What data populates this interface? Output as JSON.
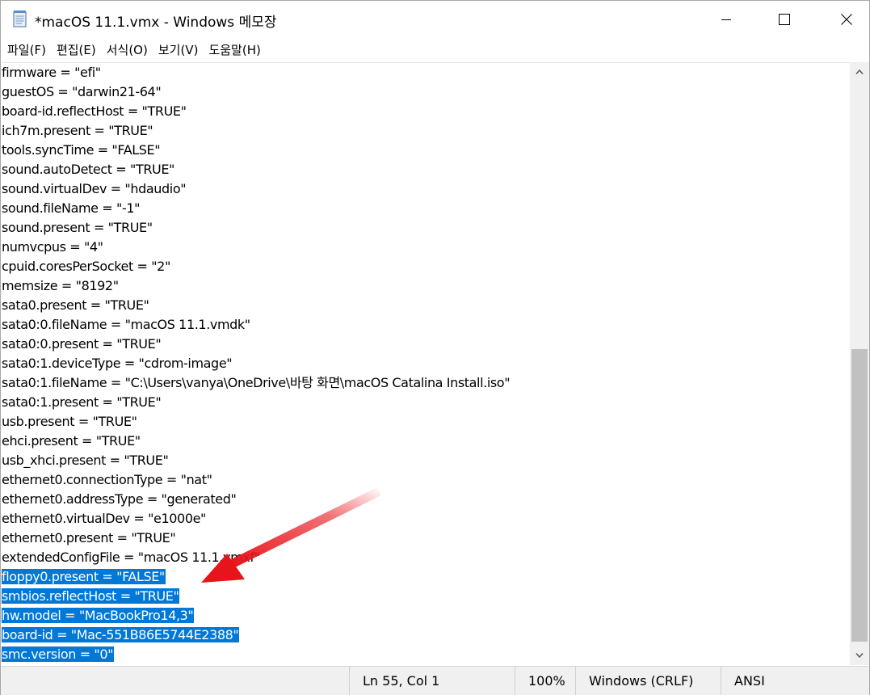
{
  "window": {
    "title": "*macOS 11.1.vmx - Windows 메모장",
    "app_icon": "notepad-icon"
  },
  "menu": {
    "items": [
      "파일(F)",
      "편집(E)",
      "서식(O)",
      "보기(V)",
      "도움말(H)"
    ]
  },
  "editor": {
    "lines": [
      "firmware = \"efi\"",
      "guestOS = \"darwin21-64\"",
      "board-id.reflectHost = \"TRUE\"",
      "ich7m.present = \"TRUE\"",
      "tools.syncTime = \"FALSE\"",
      "sound.autoDetect = \"TRUE\"",
      "sound.virtualDev = \"hdaudio\"",
      "sound.fileName = \"-1\"",
      "sound.present = \"TRUE\"",
      "numvcpus = \"4\"",
      "cpuid.coresPerSocket = \"2\"",
      "memsize = \"8192\"",
      "sata0.present = \"TRUE\"",
      "sata0:0.fileName = \"macOS 11.1.vmdk\"",
      "sata0:0.present = \"TRUE\"",
      "sata0:1.deviceType = \"cdrom-image\"",
      "sata0:1.fileName = \"C:\\Users\\vanya\\OneDrive\\바탕 화면\\macOS Catalina Install.iso\"",
      "sata0:1.present = \"TRUE\"",
      "usb.present = \"TRUE\"",
      "ehci.present = \"TRUE\"",
      "usb_xhci.present = \"TRUE\"",
      "ethernet0.connectionType = \"nat\"",
      "ethernet0.addressType = \"generated\"",
      "ethernet0.virtualDev = \"e1000e\"",
      "ethernet0.present = \"TRUE\"",
      "extendedConfigFile = \"macOS 11.1.vmxf\""
    ],
    "selected_lines": [
      "floppy0.present = \"FALSE\"",
      "smbios.reflectHost = \"TRUE\"",
      "hw.model = \"MacBookPro14,3\"",
      "board-id = \"Mac-551B86E5744E2388\"",
      "smc.version = \"0\""
    ],
    "selection_color": "#0078d7"
  },
  "statusbar": {
    "position": "Ln 55, Col 1",
    "zoom": "100%",
    "line_ending": "Windows (CRLF)",
    "encoding": "ANSI"
  },
  "annotation": {
    "arrow_color": "#e8141c"
  }
}
